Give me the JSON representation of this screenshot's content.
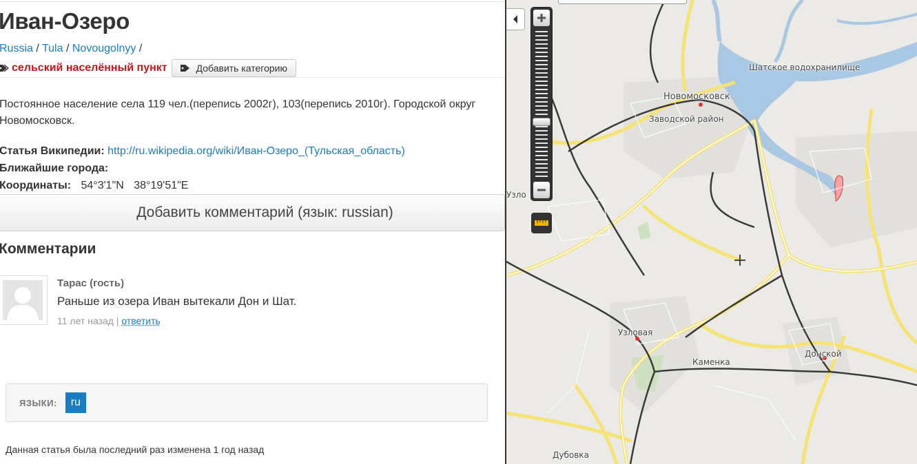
{
  "page": {
    "title": "Иван-Озеро",
    "breadcrumb": [
      "Russia",
      "Tula",
      "Novougolnyy"
    ],
    "breadcrumb_sep": "/",
    "category": "сельский населённый пункт",
    "add_category_label": "Добавить категорию",
    "description_line1": "Постоянное население села 119 чел.(перепись 2002г), 103(перепись 2010г). Городской округ",
    "description_line2": "Новомосковск.",
    "wikipedia_label": "Статья Википедии:",
    "wikipedia_link": "http://ru.wikipedia.org/wiki/Иван-Озеро_(Тульская_область)",
    "nearest_label": "Ближайшие города:",
    "coords_label": "Координаты:",
    "lat": "54°3'1\"N",
    "lon": "38°19'51\"E"
  },
  "comments": {
    "add_button": "Добавить комментарий (язык: russian)",
    "heading": "Комментарии",
    "items": [
      {
        "author": "Тарас (гость)",
        "text": "Раньше из озера Иван вытекали Дон и Шат.",
        "time": "11 лет назад",
        "sep": "|",
        "reply": "ответить"
      }
    ]
  },
  "languages": {
    "label": "ЯЗЫКИ:",
    "items": [
      "ru"
    ]
  },
  "footer": "Данная статья была последний раз изменена 1 год назад",
  "map": {
    "labels": {
      "reservoir": "Шатское водохранилище",
      "novomoskovsk": "Новомосковск",
      "zavodskoy": "Заводской район",
      "uzlovaya": "Узловая",
      "kamenka": "Каменка",
      "donskoy": "Донской",
      "dubovka": "Дубовка",
      "uzlo": "Узло"
    },
    "colors": {
      "water": "#a7c7e3",
      "road": "#f5e273",
      "rail": "#3a3a3a",
      "land": "#eceae6"
    }
  }
}
